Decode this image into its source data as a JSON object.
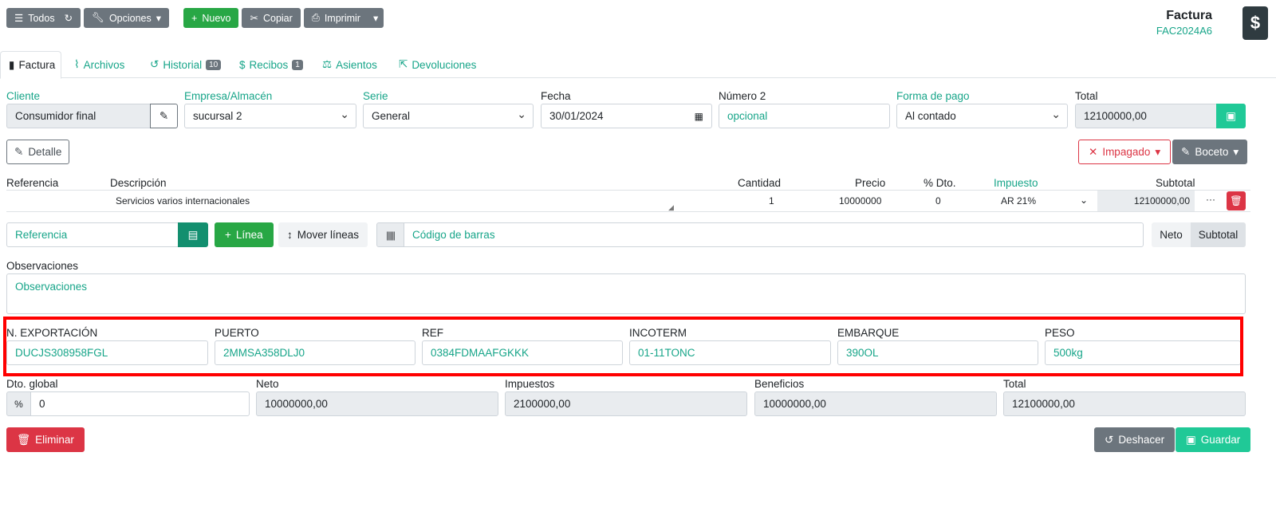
{
  "toolbar": {
    "todos": "Todos",
    "opciones": "Opciones",
    "nuevo": "Nuevo",
    "copiar": "Copiar",
    "imprimir": "Imprimir"
  },
  "doc": {
    "title": "Factura",
    "code": "FAC2024A6"
  },
  "tabs": [
    {
      "label": "Factura"
    },
    {
      "label": "Archivos"
    },
    {
      "label": "Historial",
      "badge": "10"
    },
    {
      "label": "Recibos",
      "badge": "1"
    },
    {
      "label": "Asientos"
    },
    {
      "label": "Devoluciones"
    }
  ],
  "header_fields": {
    "cliente_label": "Cliente",
    "cliente_value": "Consumidor final",
    "empresa_label": "Empresa/Almacén",
    "empresa_value": "sucursal 2",
    "serie_label": "Serie",
    "serie_value": "General",
    "fecha_label": "Fecha",
    "fecha_value": "30/01/2024",
    "numero2_label": "Número 2",
    "numero2_placeholder": "opcional",
    "forma_pago_label": "Forma de pago",
    "forma_pago_value": "Al contado",
    "total_label": "Total",
    "total_value": "12100000,00"
  },
  "actions": {
    "detalle": "Detalle",
    "impagado": "Impagado",
    "boceto": "Boceto"
  },
  "lines": {
    "headers": [
      "Referencia",
      "Descripción",
      "Cantidad",
      "Precio",
      "% Dto.",
      "Impuesto",
      "Subtotal"
    ],
    "rows": [
      {
        "referencia": "",
        "descripcion": "Servicios varios internacionales",
        "cantidad": "1",
        "precio": "10000000",
        "dto": "0",
        "impuesto": "AR 21%",
        "subtotal": "12100000,00"
      }
    ]
  },
  "line_tools": {
    "referencia_placeholder": "Referencia",
    "linea": "Línea",
    "mover": "Mover líneas",
    "barcode_placeholder": "Código de barras",
    "neto": "Neto",
    "subtotal": "Subtotal"
  },
  "observaciones": {
    "label": "Observaciones",
    "placeholder": "Observaciones"
  },
  "extra_fields": [
    {
      "label": "N. EXPORTACIÓN",
      "value": "DUCJS308958FGL"
    },
    {
      "label": "PUERTO",
      "value": "2MMSA358DLJ0"
    },
    {
      "label": "REF",
      "value": "0384FDMAAFGKKK"
    },
    {
      "label": "INCOTERM",
      "value": "01-11TONC"
    },
    {
      "label": "EMBARQUE",
      "value": "390OL"
    },
    {
      "label": "PESO",
      "value": "500kg"
    }
  ],
  "totals": [
    {
      "label": "Dto. global",
      "value": "0"
    },
    {
      "label": "Neto",
      "value": "10000000,00"
    },
    {
      "label": "Impuestos",
      "value": "2100000,00"
    },
    {
      "label": "Beneficios",
      "value": "10000000,00"
    },
    {
      "label": "Total",
      "value": "12100000,00"
    }
  ],
  "footer": {
    "eliminar": "Eliminar",
    "deshacer": "Deshacer",
    "guardar": "Guardar"
  }
}
